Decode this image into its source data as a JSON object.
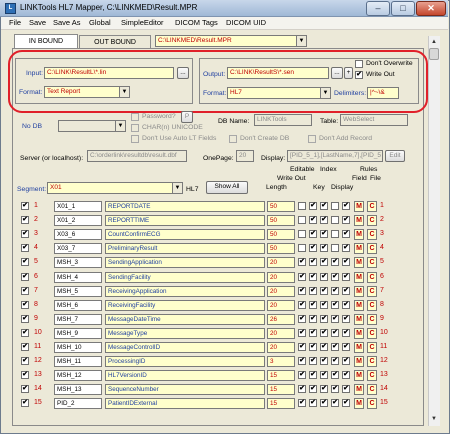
{
  "window": {
    "title": "LINKTools HL7 Mapper, C:\\LINKMED\\Result.MPR",
    "app_icon": "L",
    "minimize_glyph": "–",
    "maximize_glyph": "□",
    "close_glyph": "✕"
  },
  "menu": [
    "File",
    "Save",
    "Save As",
    "Global",
    "SimpleEditor",
    "DICOM Tags",
    "DICOM UID"
  ],
  "tabs": {
    "inbound": "IN BOUND",
    "outbound": "OUT BOUND",
    "file_path": "C:\\LINKMED\\Result.MPR"
  },
  "input": {
    "label": "Input:",
    "path": "C:\\LINK\\ResultL\\*.lin",
    "browse": "...",
    "format_label": "Format:",
    "format": "Text Report"
  },
  "output": {
    "label": "Output:",
    "path": "C:\\LINK\\ResultS\\*.sen",
    "browse": "...",
    "plus": "+",
    "format_label": "Format:",
    "format": "HL7",
    "dont_overwrite": "Don't Overwrite",
    "write_out": "Write Out",
    "delimiters_label": "Delimiters:",
    "delimiters": "|^~\\&"
  },
  "db": {
    "no_db": "No DB",
    "password": "Password?",
    "password_btn": "P",
    "char_unicode": "CHAR(n) UNICODE",
    "dont_use_lt": "Don't Use Auto LT Fields",
    "db_name_label": "DB Name:",
    "db_name": "LINKTools",
    "table_label": "Table:",
    "table": "WebSelect",
    "dont_create_db": "Don't Create DB",
    "dont_add_record": "Don't Add Record",
    "server_label": "Server (or localhost):",
    "server": "C:\\orderlink\\resultdb\\result.dbf",
    "onepage_label": "OnePage:",
    "onepage": "20",
    "display_label": "Display:",
    "display": "[PID_5_1],[LastName,7],[PID_5",
    "edit_btn": "Edit"
  },
  "segment": {
    "label": "Segment:",
    "value": "X01",
    "type": "HL7",
    "show_all": "Show All"
  },
  "headers": {
    "editable": "Editable",
    "index": "Index",
    "rules": "Rules",
    "write_out": "Write Out",
    "length": "Length",
    "key": "Key",
    "display": "Display",
    "field": "Field",
    "file": "File"
  },
  "rows": [
    {
      "num": "1",
      "name": "X01_1",
      "label": "REPORTDATE",
      "len": "50",
      "rnum": "1"
    },
    {
      "num": "2",
      "name": "X01_2",
      "label": "REPORTTIME",
      "len": "50",
      "rnum": "2"
    },
    {
      "num": "3",
      "name": "X03_6",
      "label": "CountConfirmECG",
      "len": "50",
      "rnum": "3"
    },
    {
      "num": "4",
      "name": "X03_7",
      "label": "PreliminaryResult",
      "len": "50",
      "rnum": "4"
    },
    {
      "num": "5",
      "name": "MSH_3",
      "label": "SendingApplication",
      "len": "20",
      "rnum": "5"
    },
    {
      "num": "6",
      "name": "MSH_4",
      "label": "SendingFacility",
      "len": "20",
      "rnum": "6"
    },
    {
      "num": "7",
      "name": "MSH_5",
      "label": "ReceivingApplication",
      "len": "20",
      "rnum": "7"
    },
    {
      "num": "8",
      "name": "MSH_6",
      "label": "ReceivingFacility",
      "len": "20",
      "rnum": "8"
    },
    {
      "num": "9",
      "name": "MSH_7",
      "label": "MessageDateTime",
      "len": "26",
      "rnum": "9"
    },
    {
      "num": "10",
      "name": "MSH_9",
      "label": "MessageType",
      "len": "20",
      "rnum": "10"
    },
    {
      "num": "11",
      "name": "MSH_10",
      "label": "MessageControlID",
      "len": "20",
      "rnum": "11"
    },
    {
      "num": "12",
      "name": "MSH_11",
      "label": "ProcessingID",
      "len": "3",
      "rnum": "12"
    },
    {
      "num": "13",
      "name": "MSH_12",
      "label": "HL7VersionID",
      "len": "15",
      "rnum": "13"
    },
    {
      "num": "14",
      "name": "MSH_13",
      "label": "SequenceNumber",
      "len": "15",
      "rnum": "14"
    },
    {
      "num": "15",
      "name": "PID_2",
      "label": "PatientIDExternal",
      "len": "15",
      "rnum": "15"
    }
  ],
  "rule_letters": {
    "m": "M",
    "c": "C"
  },
  "check_glyph": "✔",
  "icons": {
    "dropdown": "chevron-down-icon",
    "scroll_up": "scroll-up-icon",
    "scroll_down": "scroll-down-icon"
  },
  "glyphs": {
    "down": "▼",
    "up": "▲"
  },
  "colors": {
    "highlight_oval": "#e0202a",
    "label_blue": "#1f3fa0",
    "value_red": "#c00000",
    "field_yellow": "#ffffcc"
  }
}
